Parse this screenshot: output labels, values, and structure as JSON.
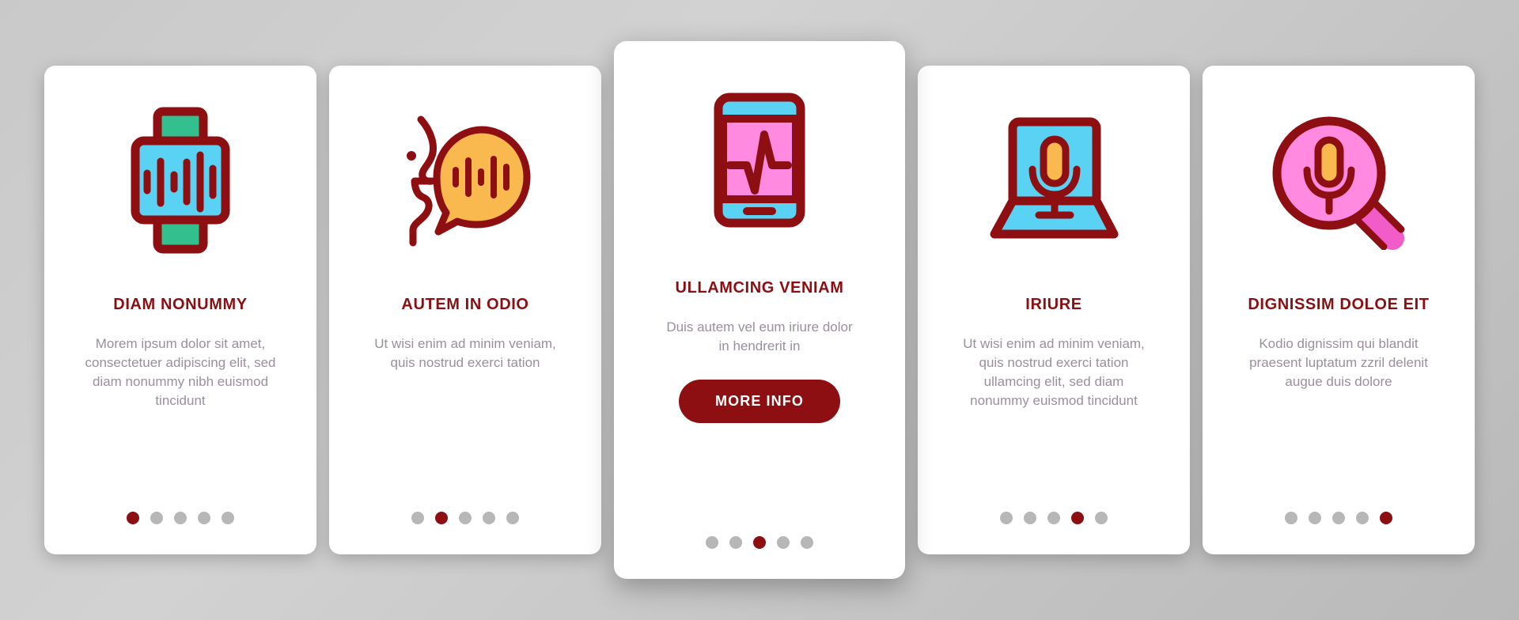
{
  "theme": {
    "background": "#c9c9c9",
    "card_bg": "#ffffff",
    "accent_dark_red": "#8d0f12",
    "title_color": "#8a0f13",
    "body_text_color": "#9a8f9c",
    "dot_inactive": "#b7b7b7",
    "icon_cyan": "#5ad2f4",
    "icon_green": "#33c08e",
    "icon_pink": "#ff8ae0",
    "icon_magenta": "#f25cc8",
    "icon_orange": "#f9b94f",
    "icon_outline": "#8d0f12"
  },
  "cards": [
    {
      "id": "card-diam-nonummy",
      "icon": "smartwatch-waveform-icon",
      "title": "DIAM NONUMMY",
      "description": "Morem ipsum dolor sit amet, consectetuer adipiscing elit, sed diam nonummy nibh euismod tincidunt",
      "featured": false,
      "dots_total": 5,
      "dot_active_index": 0,
      "button_label": null
    },
    {
      "id": "card-autem-in-odio",
      "icon": "face-speech-bubble-waveform-icon",
      "title": "AUTEM IN ODIO",
      "description": "Ut wisi enim ad minim veniam, quis nostrud exerci tation",
      "featured": false,
      "dots_total": 5,
      "dot_active_index": 1,
      "button_label": null
    },
    {
      "id": "card-ullamcing-veniam",
      "icon": "smartphone-pulse-icon",
      "title": "ULLAMCING VENIAM",
      "description": "Duis autem vel eum iriure dolor in hendrerit in",
      "featured": true,
      "dots_total": 5,
      "dot_active_index": 2,
      "button_label": "MORE INFO"
    },
    {
      "id": "card-iriure",
      "icon": "laptop-microphone-icon",
      "title": "IRIURE",
      "description": "Ut wisi enim ad minim veniam, quis nostrud exerci tation ullamcing elit, sed diam nonummy euismod tincidunt",
      "featured": false,
      "dots_total": 5,
      "dot_active_index": 3,
      "button_label": null
    },
    {
      "id": "card-dignissim-doloe-eit",
      "icon": "magnifier-microphone-icon",
      "title": "DIGNISSIM DOLOE EIT",
      "description": "Kodio dignissim qui blandit praesent luptatum zzril delenit augue duis dolore",
      "featured": false,
      "dots_total": 5,
      "dot_active_index": 4,
      "button_label": null
    }
  ]
}
